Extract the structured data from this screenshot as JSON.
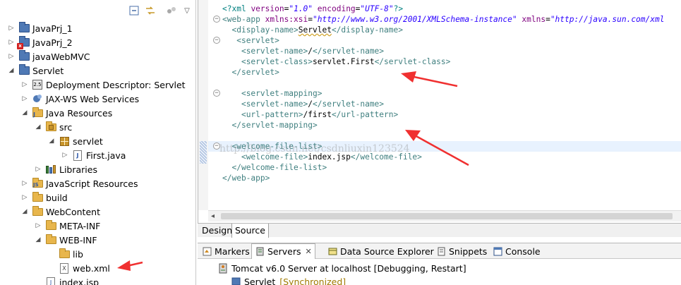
{
  "colors": {
    "arrow": "#f03030",
    "tag": "#3f7f7f",
    "attr": "#7f007f",
    "string": "#2a00ff",
    "pi": "#008080"
  },
  "explorer": {
    "toolbar": {
      "collapse_icon": "collapse-all-icon",
      "link_icon": "link-with-editor-icon",
      "menu_icon": "view-menu-icon"
    },
    "items": [
      {
        "label": "JavaPrj_1"
      },
      {
        "label": "JavaPrj_2"
      },
      {
        "label": "javaWebMVC"
      },
      {
        "label": "Servlet"
      },
      {
        "label": "Deployment Descriptor: Servlet"
      },
      {
        "label": "JAX-WS Web Services"
      },
      {
        "label": "Java Resources"
      },
      {
        "label": "src"
      },
      {
        "label": "servlet"
      },
      {
        "label": "First.java"
      },
      {
        "label": "Libraries"
      },
      {
        "label": "JavaScript Resources"
      },
      {
        "label": "build"
      },
      {
        "label": "WebContent"
      },
      {
        "label": "META-INF"
      },
      {
        "label": "WEB-INF"
      },
      {
        "label": "lib"
      },
      {
        "label": "web.xml"
      },
      {
        "label": "index.jsp"
      }
    ]
  },
  "editor": {
    "lines": [
      {
        "parts": [
          [
            "pi",
            "<?"
          ],
          [
            "pi",
            "xml "
          ],
          [
            "attr",
            "version"
          ],
          [
            "txt",
            "="
          ],
          [
            "str",
            "\"1.0\""
          ],
          [
            "txt",
            " "
          ],
          [
            "attr",
            "encoding"
          ],
          [
            "txt",
            "="
          ],
          [
            "str",
            "\"UTF-8\""
          ],
          [
            "pi",
            "?>"
          ]
        ]
      },
      {
        "parts": [
          [
            "tag",
            "<web-app "
          ],
          [
            "attr",
            "xmlns:xsi"
          ],
          [
            "txt",
            "="
          ],
          [
            "str",
            "\"http://www.w3.org/2001/XMLSchema-instance\""
          ],
          [
            "txt",
            " "
          ],
          [
            "attr",
            "xmlns"
          ],
          [
            "txt",
            "="
          ],
          [
            "str",
            "\"http://java.sun.com/xml"
          ]
        ]
      },
      {
        "parts": [
          [
            "txt",
            "  "
          ],
          [
            "tag",
            "<display-name>"
          ],
          [
            "err",
            "Servlet"
          ],
          [
            "tag",
            "</display-name>"
          ]
        ]
      },
      {
        "parts": [
          [
            "txt",
            "   "
          ],
          [
            "tag",
            "<servlet>"
          ]
        ]
      },
      {
        "parts": [
          [
            "txt",
            "    "
          ],
          [
            "tag",
            "<servlet-name>"
          ],
          [
            "txt",
            "/"
          ],
          [
            "tag",
            "</servlet-name>"
          ]
        ]
      },
      {
        "parts": [
          [
            "txt",
            "    "
          ],
          [
            "tag",
            "<servlet-class>"
          ],
          [
            "txt",
            "servlet.First"
          ],
          [
            "tag",
            "</servlet-class>"
          ]
        ]
      },
      {
        "parts": [
          [
            "txt",
            "  "
          ],
          [
            "tag",
            "</servlet>"
          ]
        ]
      },
      {
        "parts": []
      },
      {
        "parts": [
          [
            "txt",
            "    "
          ],
          [
            "tag",
            "<servlet-mapping>"
          ]
        ]
      },
      {
        "parts": [
          [
            "txt",
            "    "
          ],
          [
            "tag",
            "<servlet-name>"
          ],
          [
            "txt",
            "/"
          ],
          [
            "tag",
            "</servlet-name>"
          ]
        ]
      },
      {
        "parts": [
          [
            "txt",
            "    "
          ],
          [
            "tag",
            "<url-pattern>"
          ],
          [
            "txt",
            "/first"
          ],
          [
            "tag",
            "</url-pattern>"
          ]
        ]
      },
      {
        "parts": [
          [
            "txt",
            "  "
          ],
          [
            "tag",
            "</servlet-mapping>"
          ]
        ]
      },
      {
        "parts": []
      },
      {
        "parts": [
          [
            "txt",
            "  "
          ],
          [
            "tag",
            "<welcome-file-list>"
          ]
        ]
      },
      {
        "parts": [
          [
            "txt",
            "    "
          ],
          [
            "tag",
            "<welcome-file>"
          ],
          [
            "txt",
            "index.jsp"
          ],
          [
            "tag",
            "</welcome-file>"
          ]
        ]
      },
      {
        "parts": [
          [
            "txt",
            "  "
          ],
          [
            "tag",
            "</welcome-file-list>"
          ]
        ]
      },
      {
        "parts": [
          [
            "tag",
            "</web-app>"
          ]
        ]
      }
    ],
    "watermark": "http://blog.csdn.net/csdnliuxin123524"
  },
  "view_tabs": {
    "design": "Design",
    "source": "Source"
  },
  "bottom": {
    "tabs": [
      {
        "label": "Markers",
        "icon": "markers-icon"
      },
      {
        "label": "Servers",
        "icon": "servers-icon"
      },
      {
        "label": "Data Source Explorer",
        "icon": "data-source-icon"
      },
      {
        "label": "Snippets",
        "icon": "snippets-icon"
      },
      {
        "label": "Console",
        "icon": "console-icon"
      }
    ],
    "server": "Tomcat v6.0 Server at localhost  [Debugging, Restart]",
    "module": "Servlet",
    "module_state": "[Synchronized]"
  }
}
